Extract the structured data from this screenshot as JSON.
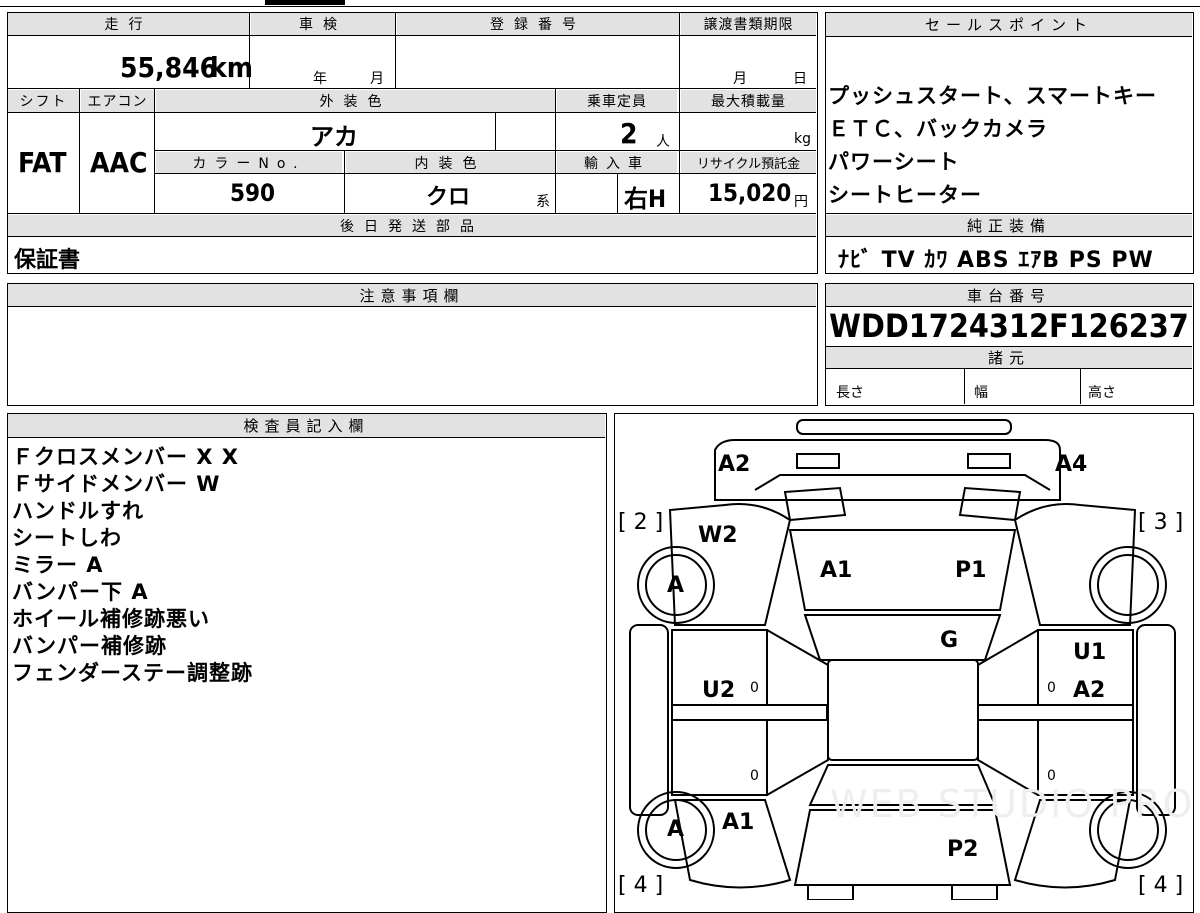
{
  "main": {
    "mileage_header": "走行",
    "mileage": "55,846",
    "mileage_unit": "km",
    "inspection_header": "車検",
    "inspection_year": "年",
    "inspection_month": "月",
    "registration_header": "登録番号",
    "transfer_header": "譲渡書類期限",
    "transfer_month": "月",
    "transfer_day": "日",
    "shift_header": "シフト",
    "shift": "FAT",
    "aircon_header": "エアコン",
    "aircon": "AAC",
    "exterior_header": "外装色",
    "exterior": "アカ",
    "capacity_header": "乗車定員",
    "capacity": "2",
    "capacity_unit": "人",
    "load_header": "最大積載量",
    "load_unit": "kg",
    "color_no_header": "カラーNo.",
    "color_no": "590",
    "interior_header": "内装色",
    "interior": "クロ",
    "interior_suffix": "系",
    "import_header": "輸入車",
    "import": "右H",
    "recycle_header": "リサイクル預託金",
    "recycle": "15,020",
    "recycle_unit": "円",
    "later_parts_header": "後日発送部品",
    "later_parts": "保証書"
  },
  "sales": {
    "header": "セールスポイント",
    "lines": [
      "プッシュスタート、スマートキー",
      "ＥＴＣ、バックカメラ",
      "パワーシート",
      "シートヒーター"
    ]
  },
  "equipment": {
    "header": "純正装備",
    "value": "ﾅﾋﾞ TV ｶﾜ ABS ｴｱB PS PW"
  },
  "notes": {
    "header": "注意事項欄"
  },
  "chassis": {
    "header": "車台番号",
    "value": "WDD1724312F126237",
    "specs_header": "諸元",
    "length": "長さ",
    "width": "幅",
    "height": "高さ"
  },
  "inspector": {
    "header": "検査員記入欄",
    "lines": [
      "Ｆクロスメンバー X X",
      "Ｆサイドメンバー W",
      "ハンドルすれ",
      "シートしわ",
      "ミラー A",
      "バンパー下 A",
      "ホイール補修跡悪い",
      "バンパー補修跡",
      "フェンダーステー調整跡"
    ]
  },
  "diagram": {
    "labels": {
      "a2_fl": "A2",
      "a4_fr": "A4",
      "w2": "W2",
      "a1": "A1",
      "p1": "P1",
      "g": "G",
      "u1": "U1",
      "u2": "U2",
      "a2_r": "A2",
      "wheel_fl": "A",
      "wheel_rl": "A",
      "a1_r": "A1",
      "p2": "P2"
    },
    "corners": {
      "c2": "[ 2 ]",
      "c3": "[ 3 ]",
      "c4l": "[ 4 ]",
      "c4r": "[ 4 ]"
    },
    "zeros": [
      "0",
      "0",
      "0",
      "0"
    ],
    "watermark": "WEB STUDIO PRO"
  }
}
